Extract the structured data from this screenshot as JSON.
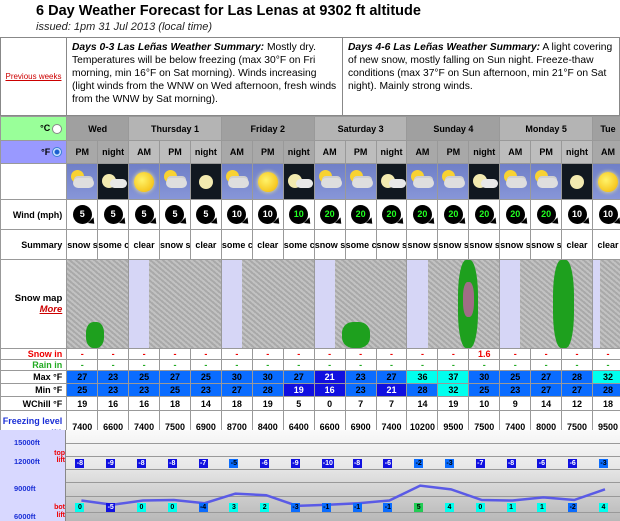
{
  "header": {
    "title": "6 Day Weather Forecast for Las Lenas at 9302 ft altitude",
    "issued": "issued: 1pm 31 Jul 2013 (local time)"
  },
  "summary": {
    "previous_weeks": "Previous weeks",
    "days_0_3_title": "Days 0-3 Las Leñas Weather Summary:",
    "days_0_3_text": " Mostly dry. Temperatures will be below freezing (max 30°F on Fri morning, min 16°F on Sat morning). Winds increasing (light winds from the WNW on Wed afternoon, fresh winds from the WNW by Sat morning).",
    "days_4_6_title": "Days 4-6 Las Leñas Weather Summary:",
    "days_4_6_text": " A light covering of new snow, mostly falling on Sun night. Freeze-thaw conditions (max 37°F on Sun afternoon, min 21°F on Sat night). Mainly strong winds."
  },
  "units": {
    "celsius": "°C",
    "fahrenheit": "°F",
    "selected": "F"
  },
  "row_labels": {
    "wind": "Wind (mph)",
    "summary": "Summary",
    "snow_map": "Snow map",
    "more": "More",
    "snow_in": "Snow in",
    "rain_in": "Rain in",
    "max": "Max °F",
    "min": "Min °F",
    "wchill": "WChill °F",
    "freezing": "Freezing level (ft)"
  },
  "days": [
    {
      "label": "Wed",
      "span": 2
    },
    {
      "label": "Thursday 1",
      "span": 3
    },
    {
      "label": "Friday 2",
      "span": 3
    },
    {
      "label": "Saturday 3",
      "span": 3
    },
    {
      "label": "Sunday 4",
      "span": 3
    },
    {
      "label": "Monday 5",
      "span": 3
    },
    {
      "label": "Tue",
      "span": 1
    }
  ],
  "periods": [
    {
      "p": "PM",
      "icon": "cloud-sun-snow-icon",
      "wind": 5,
      "wind_green": false,
      "summary": "snow shwrs",
      "snow": "-",
      "rain": "-",
      "max": 27,
      "max_c": "tb",
      "min": 25,
      "min_c": "tb",
      "wchill": 19,
      "freezing": 7400
    },
    {
      "p": "night",
      "icon": "moon-cloud-icon",
      "wind": 5,
      "wind_green": false,
      "summary": "some clouds",
      "snow": "-",
      "rain": "-",
      "max": 23,
      "max_c": "tb",
      "min": 23,
      "min_c": "tb",
      "wchill": 16,
      "freezing": 6600
    },
    {
      "p": "AM",
      "icon": "sun-icon",
      "wind": 5,
      "wind_green": false,
      "summary": "clear",
      "snow": "-",
      "rain": "-",
      "max": 25,
      "max_c": "tb",
      "min": 23,
      "min_c": "tb",
      "wchill": 16,
      "freezing": 7400
    },
    {
      "p": "PM",
      "icon": "cloud-sun-snow-icon",
      "wind": 5,
      "wind_green": false,
      "summary": "snow shwrs",
      "snow": "-",
      "rain": "-",
      "max": 27,
      "max_c": "tb",
      "min": 25,
      "min_c": "tb",
      "wchill": 18,
      "freezing": 7500
    },
    {
      "p": "night",
      "icon": "moon-icon",
      "wind": 5,
      "wind_green": false,
      "summary": "clear",
      "snow": "-",
      "rain": "-",
      "max": 25,
      "max_c": "tb",
      "min": 23,
      "min_c": "tb",
      "wchill": 14,
      "freezing": 6900
    },
    {
      "p": "AM",
      "icon": "cloud-sun-icon",
      "wind": 10,
      "wind_green": false,
      "summary": "some clouds",
      "snow": "-",
      "rain": "-",
      "max": 30,
      "max_c": "tb",
      "min": 27,
      "min_c": "tb",
      "wchill": 18,
      "freezing": 8700
    },
    {
      "p": "PM",
      "icon": "sun-icon",
      "wind": 10,
      "wind_green": false,
      "summary": "clear",
      "snow": "-",
      "rain": "-",
      "max": 30,
      "max_c": "tb",
      "min": 28,
      "min_c": "tb",
      "wchill": 19,
      "freezing": 8400
    },
    {
      "p": "night",
      "icon": "moon-cloud-icon",
      "wind": 10,
      "wind_green": true,
      "summary": "some clouds",
      "snow": "-",
      "rain": "-",
      "max": 27,
      "max_c": "tb",
      "min": 19,
      "min_c": "td",
      "wchill": 5,
      "freezing": 6400
    },
    {
      "p": "AM",
      "icon": "cloud-sun-snow-icon",
      "wind": 20,
      "wind_green": true,
      "summary": "snow shwrs",
      "snow": "-",
      "rain": "-",
      "max": 21,
      "max_c": "td",
      "min": 16,
      "min_c": "td",
      "wchill": 0,
      "freezing": 6600
    },
    {
      "p": "PM",
      "icon": "cloud-sun-icon",
      "wind": 20,
      "wind_green": true,
      "summary": "some clouds",
      "snow": "-",
      "rain": "-",
      "max": 23,
      "max_c": "tb",
      "min": 23,
      "min_c": "tb",
      "wchill": 7,
      "freezing": 6900
    },
    {
      "p": "night",
      "icon": "moon-cloud-snow-icon",
      "wind": 20,
      "wind_green": true,
      "summary": "snow shwrs",
      "snow": "-",
      "rain": "-",
      "max": 27,
      "max_c": "tb",
      "min": 21,
      "min_c": "td",
      "wchill": 7,
      "freezing": 7400
    },
    {
      "p": "AM",
      "icon": "cloud-sun-snow-icon",
      "wind": 20,
      "wind_green": true,
      "summary": "snow shwrs",
      "snow": "-",
      "rain": "-",
      "max": 36,
      "max_c": "tc",
      "min": 28,
      "min_c": "tb",
      "wchill": 14,
      "freezing": 10200
    },
    {
      "p": "PM",
      "icon": "cloud-sun-snow-icon",
      "wind": 20,
      "wind_green": true,
      "summary": "snow shwrs",
      "snow": "-",
      "rain": "-",
      "max": 37,
      "max_c": "tc",
      "min": 32,
      "min_c": "tc",
      "wchill": 19,
      "freezing": 9500
    },
    {
      "p": "night",
      "icon": "moon-cloud-snow-icon",
      "wind": 20,
      "wind_green": true,
      "summary": "snow shwrs",
      "snow": "1.6",
      "rain": "-",
      "max": 30,
      "max_c": "tb",
      "min": 25,
      "min_c": "tb",
      "wchill": 10,
      "freezing": 7500
    },
    {
      "p": "AM",
      "icon": "cloud-sun-snow-icon",
      "wind": 20,
      "wind_green": true,
      "summary": "snow shwrs",
      "snow": "-",
      "rain": "-",
      "max": 25,
      "max_c": "tb",
      "min": 23,
      "min_c": "tb",
      "wchill": 9,
      "freezing": 7400
    },
    {
      "p": "PM",
      "icon": "cloud-sun-snow-icon",
      "wind": 20,
      "wind_green": true,
      "summary": "snow shwrs",
      "snow": "-",
      "rain": "-",
      "max": 27,
      "max_c": "tb",
      "min": 27,
      "min_c": "tb",
      "wchill": 14,
      "freezing": 8000
    },
    {
      "p": "night",
      "icon": "moon-icon",
      "wind": 10,
      "wind_green": false,
      "summary": "clear",
      "snow": "-",
      "rain": "-",
      "max": 28,
      "max_c": "tb",
      "min": 27,
      "min_c": "tb",
      "wchill": 12,
      "freezing": 7500
    },
    {
      "p": "AM",
      "icon": "sun-icon",
      "wind": 10,
      "wind_green": false,
      "summary": "clear",
      "snow": "-",
      "rain": "-",
      "max": 32,
      "max_c": "tc",
      "min": 28,
      "min_c": "tb",
      "wchill": 18,
      "freezing": 9500
    }
  ],
  "snow_maps": [
    {
      "day": "Wed",
      "snow": "light-south"
    },
    {
      "day": "Thursday 1",
      "snow": "none"
    },
    {
      "day": "Friday 2",
      "snow": "none"
    },
    {
      "day": "Saturday 3",
      "snow": "light-south"
    },
    {
      "day": "Sunday 4",
      "snow": "heavy-band"
    },
    {
      "day": "Monday 5",
      "snow": "moderate-band"
    },
    {
      "day": "Tue",
      "snow": "none"
    }
  ],
  "lift_chart": {
    "axis_labels": [
      "15000ft",
      "12000ft",
      "9000ft",
      "6000ft"
    ],
    "top_lift_label": "top lift",
    "bot_lift_label": "bot lift",
    "top_lift_temps": [
      -8,
      -9,
      -8,
      -8,
      -7,
      -5,
      -6,
      -9,
      -10,
      -8,
      -6,
      -2,
      -3,
      -7,
      -8,
      -6,
      -6,
      -3
    ],
    "bot_lift_temps": [
      0,
      -5,
      0,
      0,
      -4,
      3,
      2,
      -3,
      -1,
      -1,
      -1,
      5,
      4,
      0,
      1,
      1,
      -2,
      4
    ],
    "freezing_level_ft": [
      7400,
      6600,
      7400,
      7500,
      6900,
      8700,
      8400,
      6400,
      6600,
      6900,
      7400,
      10200,
      9500,
      7500,
      7400,
      8000,
      7500,
      9500
    ]
  }
}
